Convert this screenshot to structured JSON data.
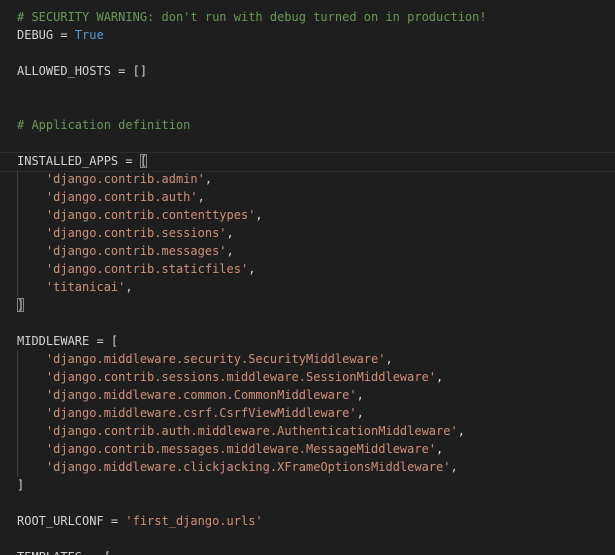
{
  "editor": {
    "language": "python",
    "cursor_line": 8,
    "colors": {
      "background": "#1e1e1e",
      "default_text": "#d4d4d4",
      "comment": "#6a9955",
      "string": "#ce9178",
      "keyword": "#569cd6"
    },
    "lines": [
      {
        "tokens": [
          {
            "t": "# SECURITY WARNING: don't run with debug turned on in production!",
            "k": "comment"
          }
        ]
      },
      {
        "tokens": [
          {
            "t": "DEBUG = ",
            "k": "ident"
          },
          {
            "t": "True",
            "k": "keyword"
          }
        ]
      },
      {
        "tokens": []
      },
      {
        "tokens": [
          {
            "t": "ALLOWED_HOSTS = []",
            "k": "ident"
          }
        ]
      },
      {
        "tokens": []
      },
      {
        "tokens": []
      },
      {
        "tokens": [
          {
            "t": "# Application definition",
            "k": "comment"
          }
        ]
      },
      {
        "tokens": []
      },
      {
        "tokens": [
          {
            "t": "INSTALLED_APPS = ",
            "k": "ident"
          },
          {
            "t": "[",
            "k": "punct",
            "match": true
          }
        ]
      },
      {
        "tokens": [
          {
            "t": "    ",
            "k": "ident"
          },
          {
            "t": "'django.contrib.admin'",
            "k": "string"
          },
          {
            "t": ",",
            "k": "punct"
          }
        ]
      },
      {
        "tokens": [
          {
            "t": "    ",
            "k": "ident"
          },
          {
            "t": "'django.contrib.auth'",
            "k": "string"
          },
          {
            "t": ",",
            "k": "punct"
          }
        ]
      },
      {
        "tokens": [
          {
            "t": "    ",
            "k": "ident"
          },
          {
            "t": "'django.contrib.contenttypes'",
            "k": "string"
          },
          {
            "t": ",",
            "k": "punct"
          }
        ]
      },
      {
        "tokens": [
          {
            "t": "    ",
            "k": "ident"
          },
          {
            "t": "'django.contrib.sessions'",
            "k": "string"
          },
          {
            "t": ",",
            "k": "punct"
          }
        ]
      },
      {
        "tokens": [
          {
            "t": "    ",
            "k": "ident"
          },
          {
            "t": "'django.contrib.messages'",
            "k": "string"
          },
          {
            "t": ",",
            "k": "punct"
          }
        ]
      },
      {
        "tokens": [
          {
            "t": "    ",
            "k": "ident"
          },
          {
            "t": "'django.contrib.staticfiles'",
            "k": "string"
          },
          {
            "t": ",",
            "k": "punct"
          }
        ]
      },
      {
        "tokens": [
          {
            "t": "    ",
            "k": "ident"
          },
          {
            "t": "'titanicai'",
            "k": "string"
          },
          {
            "t": ",",
            "k": "punct"
          }
        ]
      },
      {
        "tokens": [
          {
            "t": "]",
            "k": "punct",
            "match": true
          }
        ]
      },
      {
        "tokens": []
      },
      {
        "tokens": [
          {
            "t": "MIDDLEWARE = [",
            "k": "ident"
          }
        ]
      },
      {
        "tokens": [
          {
            "t": "    ",
            "k": "ident"
          },
          {
            "t": "'django.middleware.security.SecurityMiddleware'",
            "k": "string"
          },
          {
            "t": ",",
            "k": "punct"
          }
        ]
      },
      {
        "tokens": [
          {
            "t": "    ",
            "k": "ident"
          },
          {
            "t": "'django.contrib.sessions.middleware.SessionMiddleware'",
            "k": "string"
          },
          {
            "t": ",",
            "k": "punct"
          }
        ]
      },
      {
        "tokens": [
          {
            "t": "    ",
            "k": "ident"
          },
          {
            "t": "'django.middleware.common.CommonMiddleware'",
            "k": "string"
          },
          {
            "t": ",",
            "k": "punct"
          }
        ]
      },
      {
        "tokens": [
          {
            "t": "    ",
            "k": "ident"
          },
          {
            "t": "'django.middleware.csrf.CsrfViewMiddleware'",
            "k": "string"
          },
          {
            "t": ",",
            "k": "punct"
          }
        ]
      },
      {
        "tokens": [
          {
            "t": "    ",
            "k": "ident"
          },
          {
            "t": "'django.contrib.auth.middleware.AuthenticationMiddleware'",
            "k": "string"
          },
          {
            "t": ",",
            "k": "punct"
          }
        ]
      },
      {
        "tokens": [
          {
            "t": "    ",
            "k": "ident"
          },
          {
            "t": "'django.contrib.messages.middleware.MessageMiddleware'",
            "k": "string"
          },
          {
            "t": ",",
            "k": "punct"
          }
        ]
      },
      {
        "tokens": [
          {
            "t": "    ",
            "k": "ident"
          },
          {
            "t": "'django.middleware.clickjacking.XFrameOptionsMiddleware'",
            "k": "string"
          },
          {
            "t": ",",
            "k": "punct"
          }
        ]
      },
      {
        "tokens": [
          {
            "t": "]",
            "k": "punct"
          }
        ]
      },
      {
        "tokens": []
      },
      {
        "tokens": [
          {
            "t": "ROOT_URLCONF = ",
            "k": "ident"
          },
          {
            "t": "'first_django.urls'",
            "k": "string"
          }
        ]
      },
      {
        "tokens": []
      },
      {
        "tokens": [
          {
            "t": "TEMPLATES = [",
            "k": "ident"
          }
        ]
      }
    ]
  }
}
